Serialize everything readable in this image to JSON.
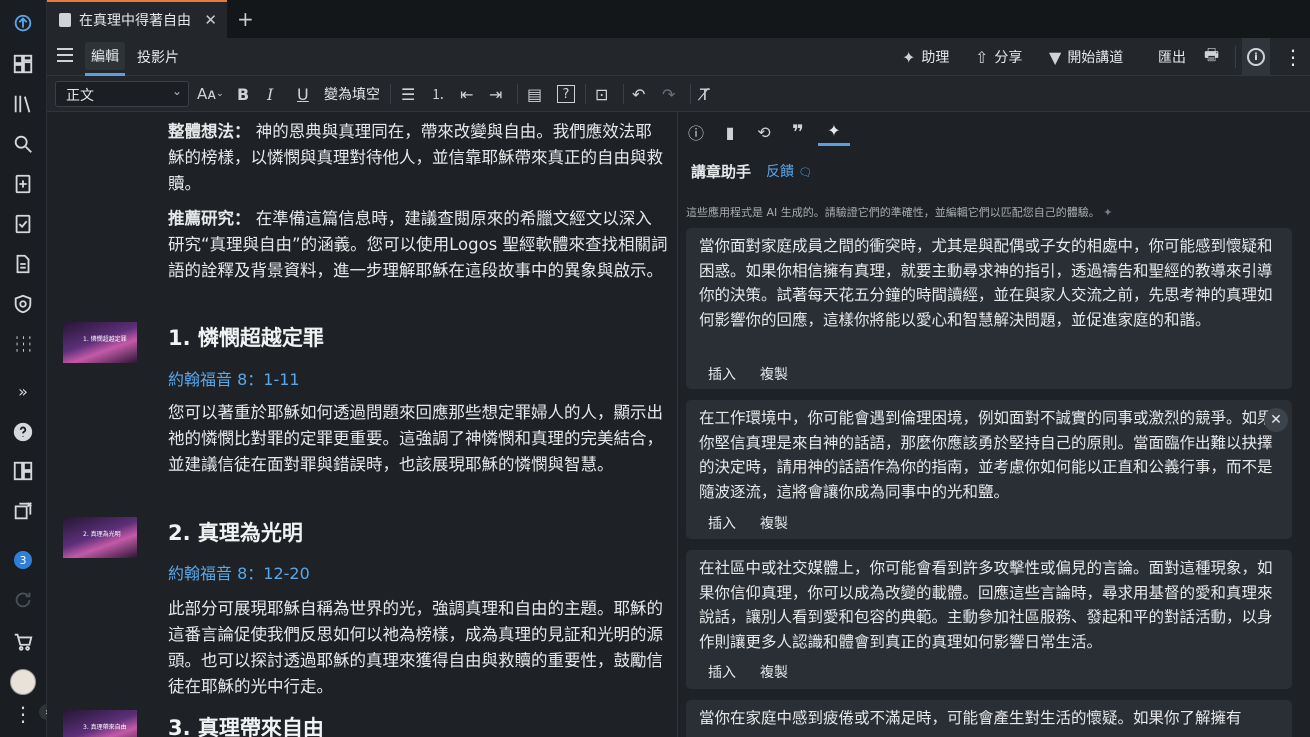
{
  "tab": {
    "title": "在真理中得著自由"
  },
  "header": {
    "mode_edit": "編輯",
    "mode_slides": "投影片",
    "assist": "助理",
    "share": "分享",
    "start_preaching": "開始講道",
    "export": "匯出"
  },
  "toolbar": {
    "style_value": "正文",
    "fill_blank": "變為填空"
  },
  "rail": {
    "badge_count": "3"
  },
  "editor": {
    "p1_label": "整體想法：",
    "p1_text": " 神的恩典與真理同在，帶來改變與自由。我們應效法耶穌的榜樣，以憐憫與真理對待他人，並信靠耶穌帶來真正的自由與救贖。",
    "p2_label": "推薦研究：",
    "p2_text": " 在準備這篇信息時，建議查閱原來的希臘文經文以深入研究“真理與自由”的涵義。您可以使用Logos 聖經軟體來查找相關詞語的詮釋及背景資料，進一步理解耶穌在這段故事中的異象與啟示。",
    "sections": [
      {
        "thumb": "1. 憐憫超越定罪",
        "heading": "1. 憐憫超越定罪",
        "ref": "約翰福音 8：1-11",
        "body": "您可以著重於耶穌如何透過問題來回應那些想定罪婦人的人，顯示出祂的憐憫比對罪的定罪更重要。這強調了神憐憫和真理的完美結合，並建議信徒在面對罪與錯誤時，也該展現耶穌的憐憫與智慧。"
      },
      {
        "thumb": "2. 真理為光明",
        "heading": "2. 真理為光明",
        "ref": "約翰福音 8：12-20",
        "body": "此部分可展現耶穌自稱為世界的光，強調真理和自由的主題。耶穌的這番言論促使我們反思如何以祂為榜樣，成為真理的見証和光明的源頭。也可以探討透過耶穌的真理來獲得自由與救贖的重要性，鼓勵信徒在耶穌的光中行走。"
      },
      {
        "thumb": "3. 真理帶來自由",
        "heading": "3. 真理帶來自由"
      }
    ]
  },
  "panel": {
    "title": "講章助手",
    "feedback": "反饋",
    "disclaimer": "這些應用程式是 AI 生成的。請驗證它們的準確性，並編輯它們以匹配您自己的體驗。",
    "insert": "插入",
    "copy": "複製",
    "cards": [
      "當你面對家庭成員之間的衝突時，尤其是與配偶或子女的相處中，你可能感到懷疑和困惑。如果你相信擁有真理，就要主動尋求神的指引，透過禱告和聖經的教導來引導你的決策。試著每天花五分鐘的時間讀經，並在與家人交流之前，先思考神的真理如何影響你的回應，這樣你將能以愛心和智慧解決問題，並促進家庭的和諧。",
      "在工作環境中，你可能會遇到倫理困境，例如面對不誠實的同事或激烈的競爭。如果你堅信真理是來自神的話語，那麼你應該勇於堅持自己的原則。當面臨作出難以抉擇的決定時，請用神的話語作為你的指南，並考慮你如何能以正直和公義行事，而不是隨波逐流，這將會讓你成為同事中的光和鹽。",
      "在社區中或社交媒體上，你可能會看到許多攻擊性或偏見的言論。面對這種現象，如果你信仰真理，你可以成為改變的載體。回應這些言論時，尋求用基督的愛和真理來說話，讓別人看到愛和包容的典範。主動參加社區服務、發起和平的對話活動，以身作則讓更多人認識和體會到真正的真理如何影響日常生活。",
      "當你在家庭中感到疲倦或不滿足時，可能會產生對生活的懷疑。如果你了解擁有"
    ]
  }
}
